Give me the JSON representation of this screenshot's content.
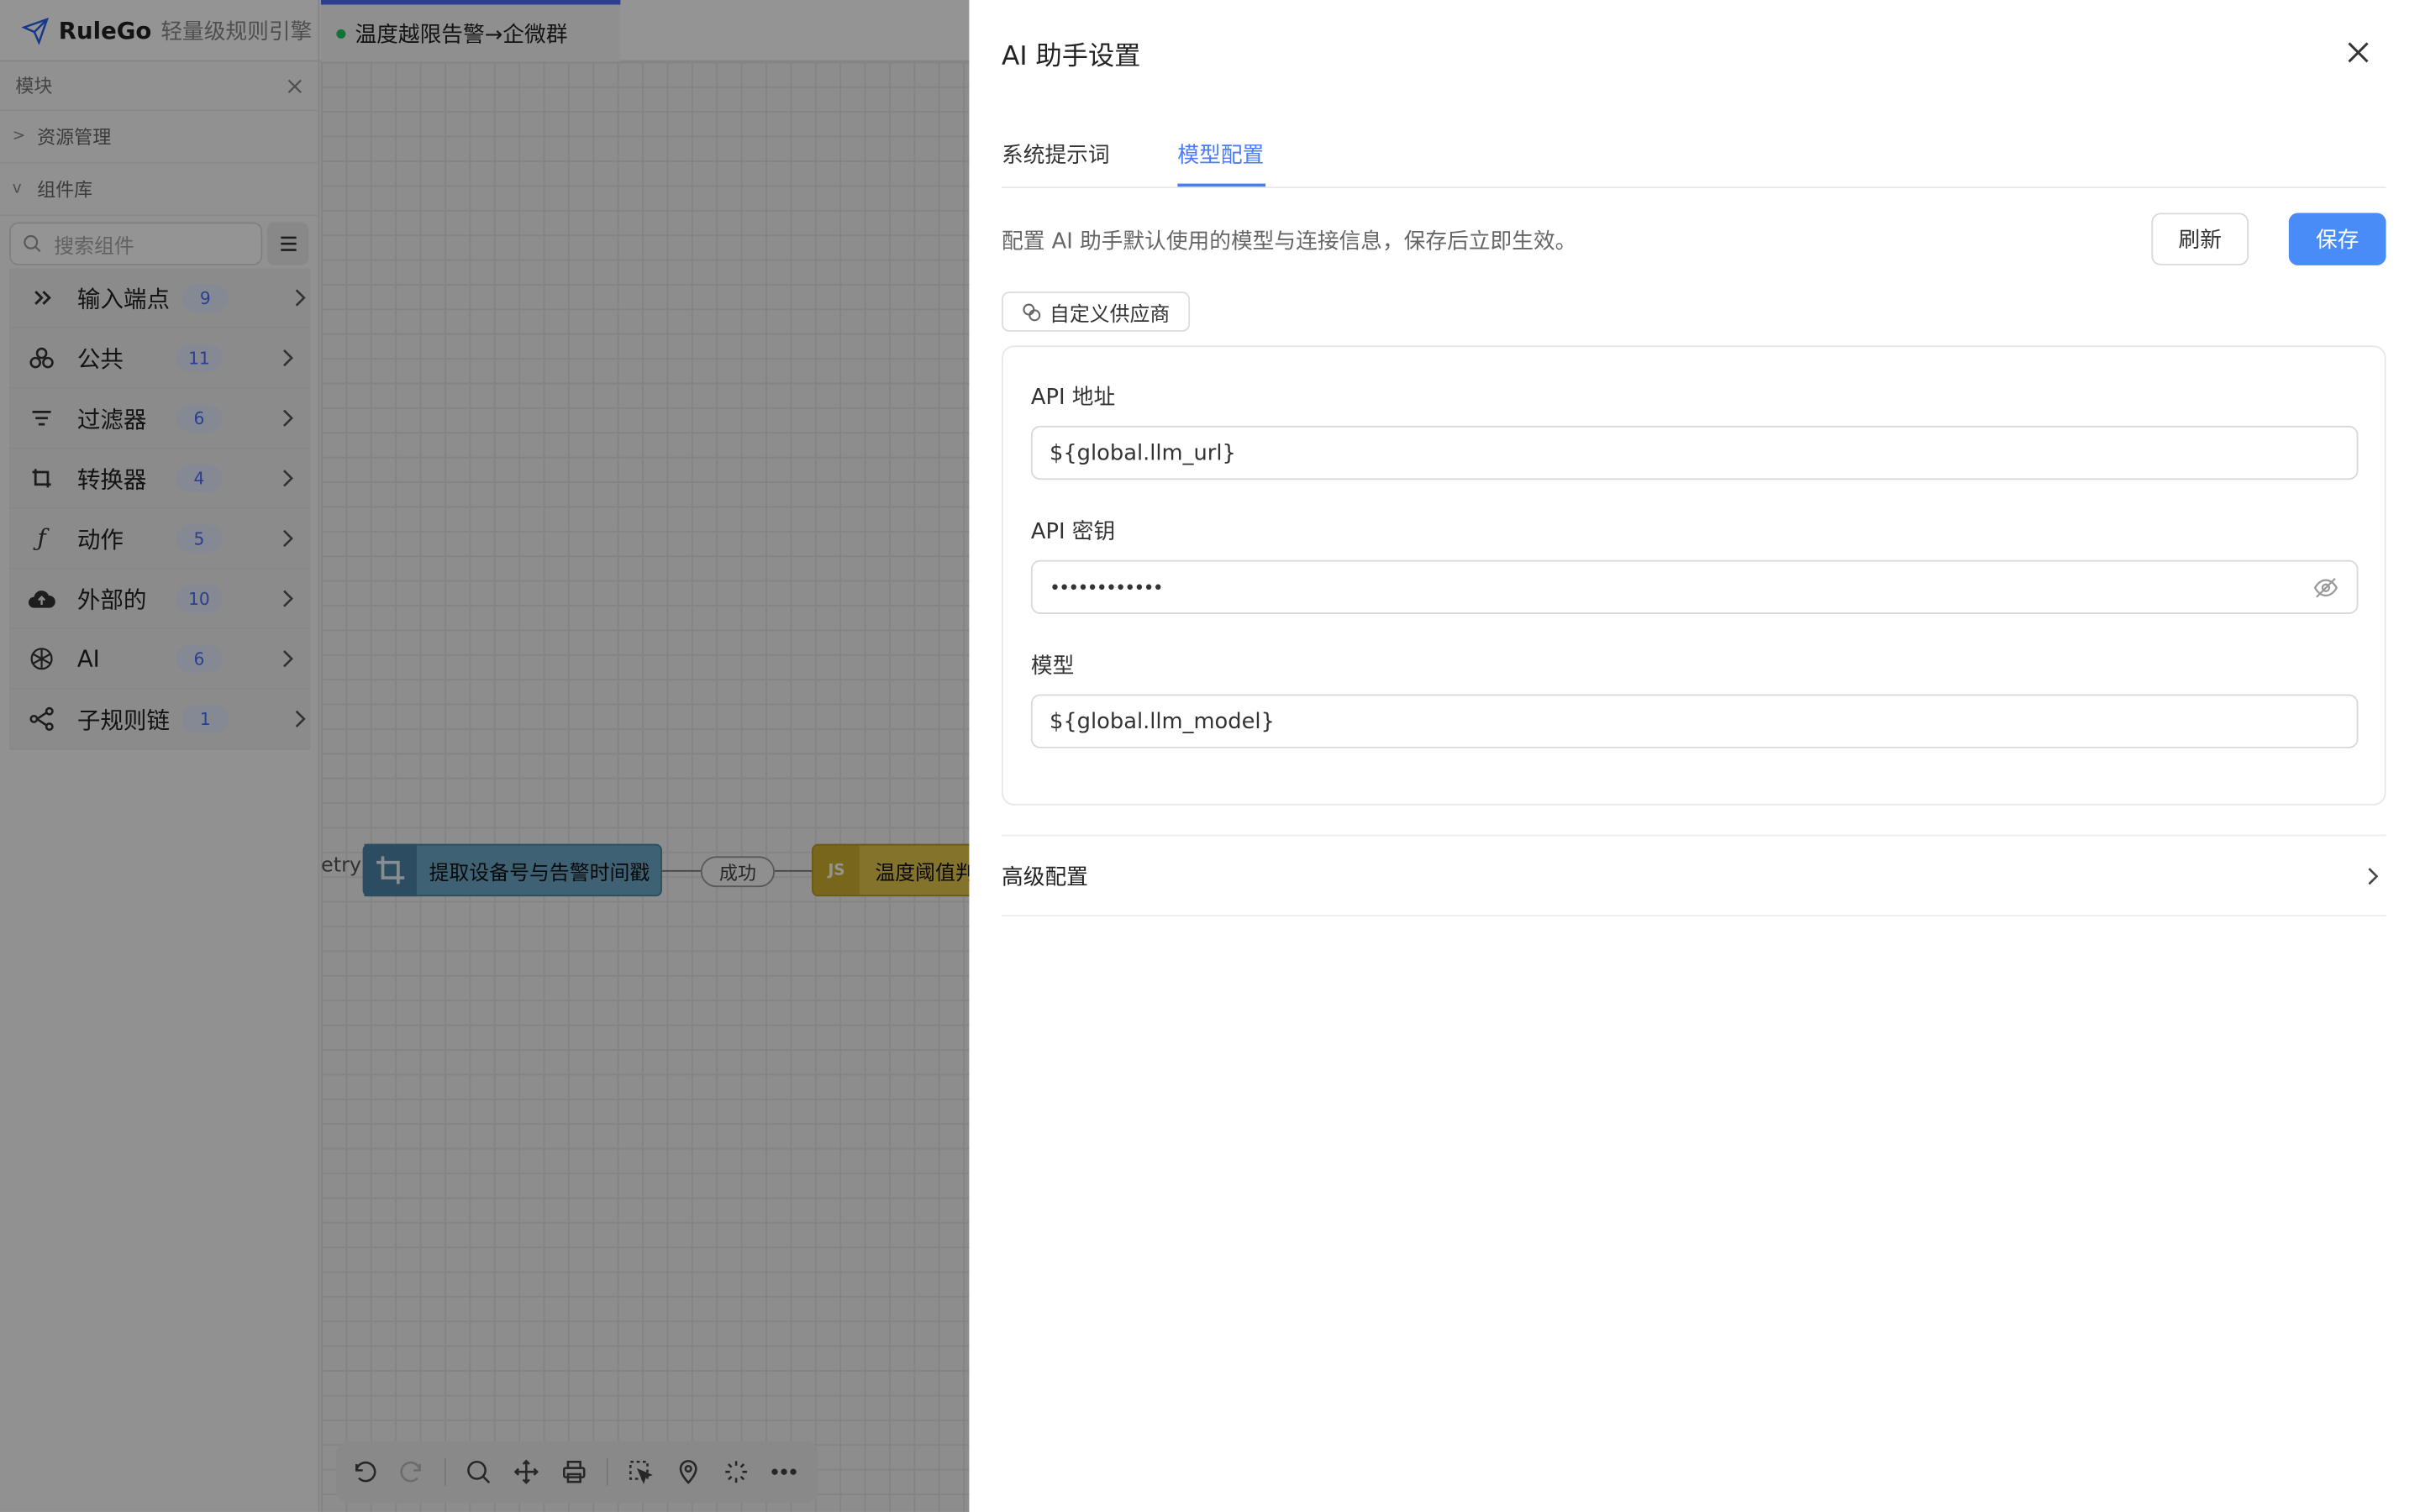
{
  "app": {
    "name": "RuleGo",
    "subtitle": "轻量级规则引擎"
  },
  "chain_tab": {
    "label": "温度越限告警→企微群",
    "status_color": "#22c55e"
  },
  "sidebar": {
    "header": "模块",
    "resource_section": "资源管理",
    "library_section": "组件库",
    "search_placeholder": "搜索组件",
    "categories": [
      {
        "label": "输入端点",
        "count": "9",
        "icon": "input-endpoint-icon"
      },
      {
        "label": "公共",
        "count": "11",
        "icon": "common-icon"
      },
      {
        "label": "过滤器",
        "count": "6",
        "icon": "filter-icon"
      },
      {
        "label": "转换器",
        "count": "4",
        "icon": "transform-icon"
      },
      {
        "label": "动作",
        "count": "5",
        "icon": "function-icon"
      },
      {
        "label": "外部的",
        "count": "10",
        "icon": "cloud-upload-icon"
      },
      {
        "label": "AI",
        "count": "6",
        "icon": "ai-icon"
      },
      {
        "label": "子规则链",
        "count": "1",
        "icon": "sub-chain-icon"
      }
    ]
  },
  "canvas": {
    "edge_left_label": "etry",
    "node1_label": "提取设备号与告警时间戳",
    "edge_label": "成功",
    "node2_label": "温度阈值判断",
    "node2_icon_text": "JS"
  },
  "drawer": {
    "title": "AI 助手设置",
    "tabs": [
      "系统提示词",
      "模型配置"
    ],
    "active_tab": "模型配置",
    "description": "配置 AI 助手默认使用的模型与连接信息，保存后立即生效。",
    "refresh_label": "刷新",
    "save_label": "保存",
    "provider_chip": "自定义供应商",
    "fields": {
      "api_url": {
        "label": "API 地址",
        "value": "${global.llm_url}"
      },
      "api_key": {
        "label": "API 密钥",
        "value": "••••••••••••"
      },
      "model": {
        "label": "模型",
        "value": "${global.llm_model}"
      }
    },
    "advanced_label": "高级配置"
  },
  "colors": {
    "accent": "#4a8cf7",
    "tab_active": "#4a7cf7",
    "node_transform": "#6ba8c9",
    "node_js": "#e3c84a"
  }
}
